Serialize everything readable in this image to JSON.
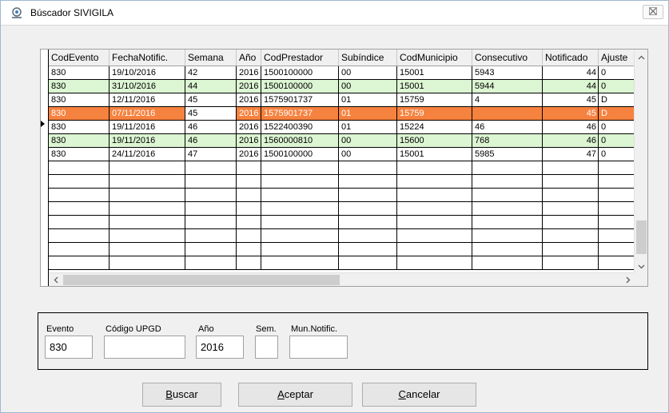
{
  "window": {
    "title": "Búscador SIVIGILA",
    "icon": "sivigila-logo-icon",
    "close_icon": "close-icon"
  },
  "grid": {
    "columns": [
      "CodEvento",
      "FechaNotific.",
      "Semana",
      "Año",
      "CodPrestador",
      "Subíndice",
      "CodMunicipio",
      "Consecutivo",
      "Notificado",
      "Ajuste"
    ],
    "rows": [
      {
        "style": "white",
        "cells": [
          "830",
          "19/10/2016",
          "42",
          "2016",
          "1500100000",
          "00",
          "15001",
          "5943",
          "44",
          "0"
        ]
      },
      {
        "style": "green",
        "cells": [
          "830",
          "31/10/2016",
          "44",
          "2016",
          "1500100000",
          "00",
          "15001",
          "5944",
          "44",
          "0"
        ]
      },
      {
        "style": "white",
        "cells": [
          "830",
          "12/11/2016",
          "45",
          "2016",
          "1575901737",
          "01",
          "15759",
          "4",
          "45",
          "D"
        ]
      },
      {
        "style": "selected",
        "cells": [
          "830",
          "07/11/2016",
          "45",
          "2016",
          "1575901737",
          "01",
          "15759",
          "",
          "45",
          "D"
        ]
      },
      {
        "style": "white",
        "cells": [
          "830",
          "19/11/2016",
          "46",
          "2016",
          "1522400390",
          "01",
          "15224",
          "46",
          "46",
          "0"
        ]
      },
      {
        "style": "green",
        "cells": [
          "830",
          "19/11/2016",
          "46",
          "2016",
          "1560000810",
          "00",
          "15600",
          "768",
          "46",
          "0"
        ]
      },
      {
        "style": "white",
        "cells": [
          "830",
          "24/11/2016",
          "47",
          "2016",
          "1500100000",
          "00",
          "15001",
          "5985",
          "47",
          "0"
        ]
      }
    ],
    "empty_rows": 8
  },
  "filters": {
    "evento_label": "Evento",
    "evento_value": "830",
    "upgd_label": "Código UPGD",
    "upgd_value": "",
    "anio_label": "Año",
    "anio_value": "2016",
    "sem_label": "Sem.",
    "sem_value": "",
    "mun_label": "Mun.Notific.",
    "mun_value": ""
  },
  "buttons": {
    "buscar_first": "B",
    "buscar_rest": "uscar",
    "aceptar_first": "A",
    "aceptar_rest": "ceptar",
    "cancelar_first": "C",
    "cancelar_rest": "ancelar"
  },
  "colors": {
    "selected_row": "#f6823f",
    "alt_row": "#dcf5d2"
  }
}
